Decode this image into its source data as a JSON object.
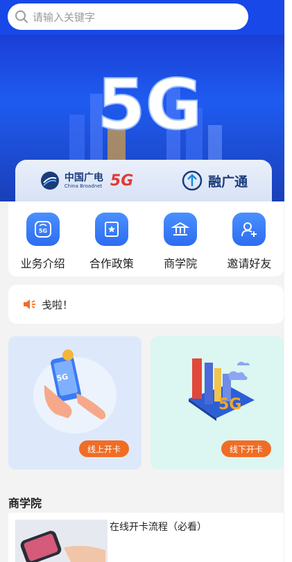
{
  "search": {
    "placeholder": "请输入关键字"
  },
  "banner": {
    "logo_text": "5G",
    "brand_cn": "中国广电",
    "brand_en": "China Broadnet",
    "brand_5g": "5G",
    "partner": "融广通"
  },
  "menu": {
    "items": [
      {
        "label": "业务介绍",
        "icon": "signal-5g-icon"
      },
      {
        "label": "合作政策",
        "icon": "star-badge-icon"
      },
      {
        "label": "商学院",
        "icon": "institution-icon"
      },
      {
        "label": "邀请好友",
        "icon": "add-user-icon"
      }
    ]
  },
  "notice": {
    "text": "戋啦！"
  },
  "open": {
    "online_label": "线上开卡",
    "offline_label": "线下开卡"
  },
  "academy": {
    "title": "商学院",
    "articles": [
      {
        "title": "在线开卡流程（必看）"
      }
    ]
  },
  "colors": {
    "primary": "#1848e8",
    "accent": "#f06d25"
  }
}
